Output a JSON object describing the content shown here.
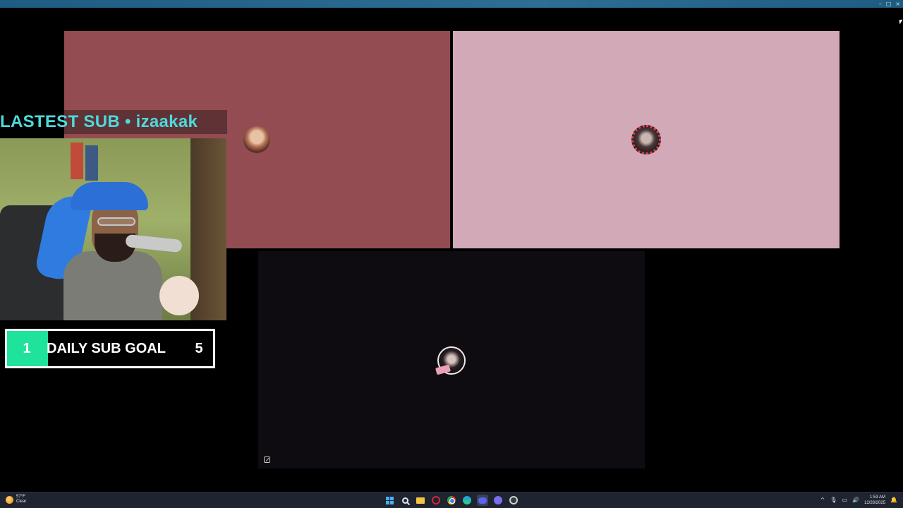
{
  "window": {
    "controls": {
      "minimize": "–",
      "maximize": "□",
      "close": "×"
    }
  },
  "participants": [
    {
      "id": "p1",
      "tile_color": "#934d52"
    },
    {
      "id": "p2",
      "tile_color": "#d2a9b6",
      "ring_color": "#e04250"
    },
    {
      "id": "p3",
      "tile_color": "#0e0c10"
    }
  ],
  "overlay": {
    "latest_sub": "LASTEST SUB • izaakak",
    "sub_goal": {
      "current": "1",
      "label": "DAILY SUB GOAL",
      "target": "5",
      "progress_fraction": 0.2,
      "fill_color": "#1fe39a"
    },
    "accent_color": "#4ed9dc"
  },
  "taskbar": {
    "weather": {
      "temp": "57°F",
      "condition": "Clear"
    },
    "apps": [
      "start-icon",
      "search-icon",
      "file-explorer-icon",
      "opera-icon",
      "chrome-icon",
      "edge-icon",
      "discord-icon",
      "app-icon",
      "obs-icon"
    ],
    "tray": {
      "chevron": "^",
      "mic": "🎙",
      "network": "▭",
      "volume": "🔊",
      "notifications": "🔔"
    },
    "clock": {
      "time": "1:53 AM",
      "date": "12/28/2025"
    }
  }
}
